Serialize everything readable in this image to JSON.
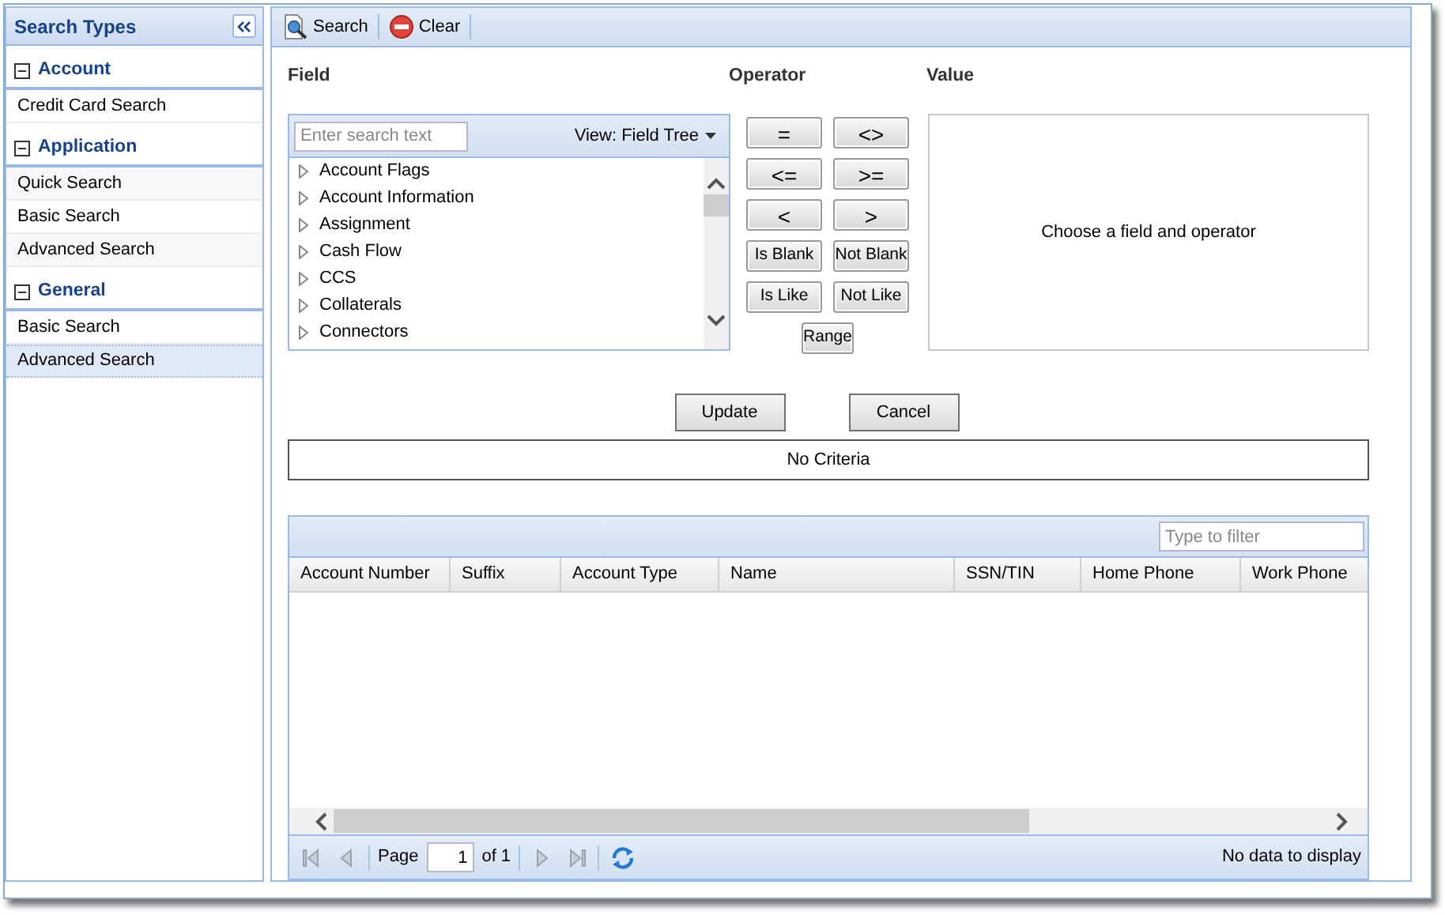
{
  "sidebar": {
    "title": "Search Types",
    "groups": [
      {
        "label": "Account",
        "expanded": true,
        "items": [
          {
            "label": "Credit Card Search",
            "selected": false
          }
        ]
      },
      {
        "label": "Application",
        "expanded": true,
        "items": [
          {
            "label": "Quick Search",
            "selected": false
          },
          {
            "label": "Basic Search",
            "selected": false
          },
          {
            "label": "Advanced Search",
            "selected": false
          }
        ]
      },
      {
        "label": "General",
        "expanded": true,
        "items": [
          {
            "label": "Basic Search",
            "selected": false
          },
          {
            "label": "Advanced Search",
            "selected": true
          }
        ]
      }
    ]
  },
  "toolbar": {
    "buttons": [
      {
        "label": "Search",
        "kind": "search"
      },
      {
        "label": "Clear",
        "kind": "clear"
      }
    ]
  },
  "field": {
    "label": "Field",
    "placeholder": "Enter search text",
    "view": "View: Field Tree",
    "items": [
      {
        "label": "Account Flags",
        "expanded": false
      },
      {
        "label": "Account Information",
        "expanded": false
      },
      {
        "label": "Assignment",
        "expanded": false
      },
      {
        "label": "Cash Flow",
        "expanded": false
      },
      {
        "label": "CCS",
        "expanded": false
      },
      {
        "label": "Collaterals",
        "expanded": false
      },
      {
        "label": "Connectors",
        "expanded": false
      }
    ]
  },
  "operator": {
    "label": "Operator",
    "buttons": [
      {
        "label": "=",
        "kind": "symbol"
      },
      {
        "label": "<>",
        "kind": "symbol"
      },
      {
        "label": "<=",
        "kind": "symbol"
      },
      {
        "label": ">=",
        "kind": "symbol"
      },
      {
        "label": "<",
        "kind": "symbol"
      },
      {
        "label": ">",
        "kind": "symbol"
      },
      {
        "label": "Is Blank",
        "kind": "word"
      },
      {
        "label": "Not Blank",
        "kind": "word"
      },
      {
        "label": "Is Like",
        "kind": "word"
      },
      {
        "label": "Not Like",
        "kind": "word"
      },
      {
        "label": "Range",
        "kind": "word"
      }
    ]
  },
  "value": {
    "label": "Value",
    "message": "Choose a field and operator"
  },
  "actions": [
    "Update",
    "Cancel"
  ],
  "criteria": "No Criteria",
  "grid": {
    "placeholder": "Type to filter",
    "columns": [
      "Account Number",
      "Suffix",
      "Account Type",
      "Name",
      "SSN/TIN",
      "Home Phone",
      "Work Phone"
    ],
    "pager": {
      "page_label": "Page",
      "page": "1",
      "of": "of 1",
      "status": "No data to display",
      "buttons": [
        {
          "kind": "first",
          "disabled": true
        },
        {
          "kind": "prev",
          "disabled": true
        },
        {
          "kind": "next",
          "disabled": true
        },
        {
          "kind": "last",
          "disabled": true
        },
        {
          "kind": "refresh",
          "disabled": false
        }
      ]
    }
  }
}
